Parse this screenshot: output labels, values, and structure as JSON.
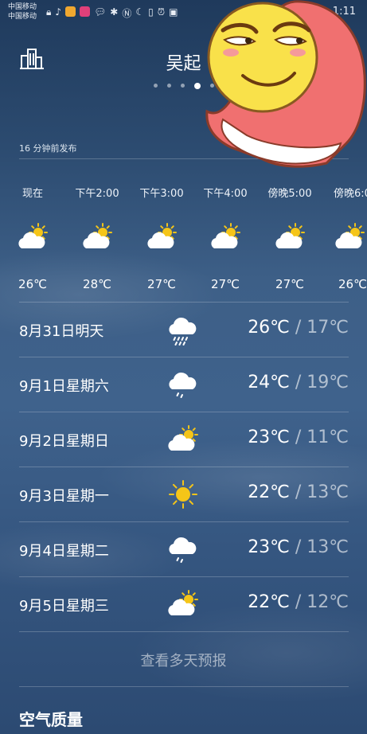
{
  "status_bar": {
    "carrier1": "中国移动",
    "carrier2": "中国移动",
    "time": "1:11"
  },
  "header": {
    "city": "吴起",
    "page_count": 5,
    "active_page": 4
  },
  "publish_text": "16 分钟前发布",
  "hourly": [
    {
      "time": "现在",
      "temp": "26℃",
      "icon": "partly-cloudy-icon"
    },
    {
      "time": "下午2:00",
      "temp": "28℃",
      "icon": "partly-cloudy-icon"
    },
    {
      "time": "下午3:00",
      "temp": "27℃",
      "icon": "partly-cloudy-icon"
    },
    {
      "time": "下午4:00",
      "temp": "27℃",
      "icon": "partly-cloudy-icon"
    },
    {
      "time": "傍晚5:00",
      "temp": "27℃",
      "icon": "partly-cloudy-icon"
    },
    {
      "time": "傍晚6:0",
      "temp": "26℃",
      "icon": "partly-cloudy-icon"
    }
  ],
  "daily": [
    {
      "label": "8月31日明天",
      "high": "26℃",
      "sep": " / ",
      "low": "17℃",
      "icon": "rain-icon"
    },
    {
      "label": "9月1日星期六",
      "high": "24℃",
      "sep": " / ",
      "low": "19℃",
      "icon": "light-rain-icon"
    },
    {
      "label": "9月2日星期日",
      "high": "23℃",
      "sep": " / ",
      "low": "11℃",
      "icon": "partly-cloudy-icon"
    },
    {
      "label": "9月3日星期一",
      "high": "22℃",
      "sep": " / ",
      "low": "13℃",
      "icon": "sunny-icon"
    },
    {
      "label": "9月4日星期二",
      "high": "23℃",
      "sep": " / ",
      "low": "13℃",
      "icon": "light-rain-icon"
    },
    {
      "label": "9月5日星期三",
      "high": "22℃",
      "sep": " / ",
      "low": "12℃",
      "icon": "partly-cloudy-icon"
    }
  ],
  "more_forecast": "查看多天预报",
  "air_quality_title": "空气质量",
  "colors": {
    "sun": "#f5c518",
    "cloud": "#ffffff",
    "sticker_face": "#f9e14a",
    "sticker_hood": "#f06d6d"
  }
}
